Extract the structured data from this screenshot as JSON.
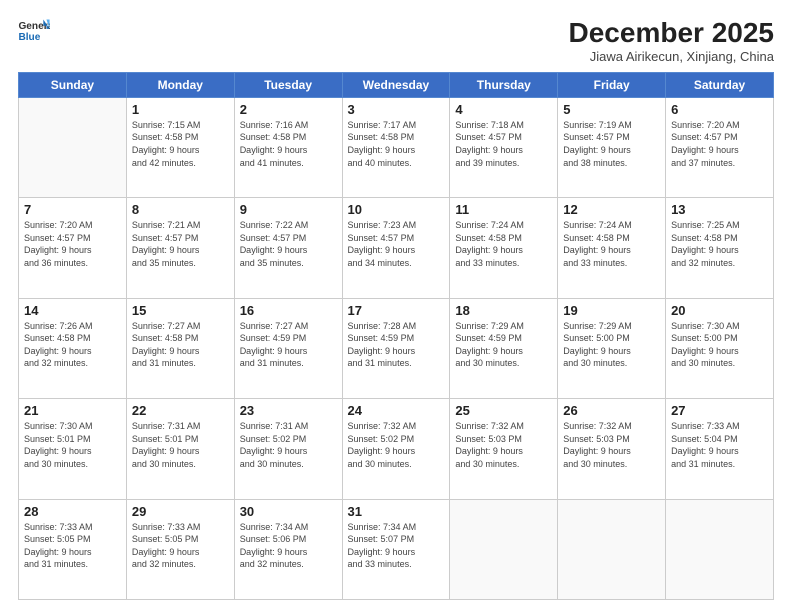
{
  "logo": {
    "line1": "General",
    "line2": "Blue"
  },
  "title": "December 2025",
  "subtitle": "Jiawa Airikecun, Xinjiang, China",
  "days_of_week": [
    "Sunday",
    "Monday",
    "Tuesday",
    "Wednesday",
    "Thursday",
    "Friday",
    "Saturday"
  ],
  "weeks": [
    [
      {
        "day": "",
        "info": ""
      },
      {
        "day": "1",
        "info": "Sunrise: 7:15 AM\nSunset: 4:58 PM\nDaylight: 9 hours\nand 42 minutes."
      },
      {
        "day": "2",
        "info": "Sunrise: 7:16 AM\nSunset: 4:58 PM\nDaylight: 9 hours\nand 41 minutes."
      },
      {
        "day": "3",
        "info": "Sunrise: 7:17 AM\nSunset: 4:58 PM\nDaylight: 9 hours\nand 40 minutes."
      },
      {
        "day": "4",
        "info": "Sunrise: 7:18 AM\nSunset: 4:57 PM\nDaylight: 9 hours\nand 39 minutes."
      },
      {
        "day": "5",
        "info": "Sunrise: 7:19 AM\nSunset: 4:57 PM\nDaylight: 9 hours\nand 38 minutes."
      },
      {
        "day": "6",
        "info": "Sunrise: 7:20 AM\nSunset: 4:57 PM\nDaylight: 9 hours\nand 37 minutes."
      }
    ],
    [
      {
        "day": "7",
        "info": "Sunrise: 7:20 AM\nSunset: 4:57 PM\nDaylight: 9 hours\nand 36 minutes."
      },
      {
        "day": "8",
        "info": "Sunrise: 7:21 AM\nSunset: 4:57 PM\nDaylight: 9 hours\nand 35 minutes."
      },
      {
        "day": "9",
        "info": "Sunrise: 7:22 AM\nSunset: 4:57 PM\nDaylight: 9 hours\nand 35 minutes."
      },
      {
        "day": "10",
        "info": "Sunrise: 7:23 AM\nSunset: 4:57 PM\nDaylight: 9 hours\nand 34 minutes."
      },
      {
        "day": "11",
        "info": "Sunrise: 7:24 AM\nSunset: 4:58 PM\nDaylight: 9 hours\nand 33 minutes."
      },
      {
        "day": "12",
        "info": "Sunrise: 7:24 AM\nSunset: 4:58 PM\nDaylight: 9 hours\nand 33 minutes."
      },
      {
        "day": "13",
        "info": "Sunrise: 7:25 AM\nSunset: 4:58 PM\nDaylight: 9 hours\nand 32 minutes."
      }
    ],
    [
      {
        "day": "14",
        "info": "Sunrise: 7:26 AM\nSunset: 4:58 PM\nDaylight: 9 hours\nand 32 minutes."
      },
      {
        "day": "15",
        "info": "Sunrise: 7:27 AM\nSunset: 4:58 PM\nDaylight: 9 hours\nand 31 minutes."
      },
      {
        "day": "16",
        "info": "Sunrise: 7:27 AM\nSunset: 4:59 PM\nDaylight: 9 hours\nand 31 minutes."
      },
      {
        "day": "17",
        "info": "Sunrise: 7:28 AM\nSunset: 4:59 PM\nDaylight: 9 hours\nand 31 minutes."
      },
      {
        "day": "18",
        "info": "Sunrise: 7:29 AM\nSunset: 4:59 PM\nDaylight: 9 hours\nand 30 minutes."
      },
      {
        "day": "19",
        "info": "Sunrise: 7:29 AM\nSunset: 5:00 PM\nDaylight: 9 hours\nand 30 minutes."
      },
      {
        "day": "20",
        "info": "Sunrise: 7:30 AM\nSunset: 5:00 PM\nDaylight: 9 hours\nand 30 minutes."
      }
    ],
    [
      {
        "day": "21",
        "info": "Sunrise: 7:30 AM\nSunset: 5:01 PM\nDaylight: 9 hours\nand 30 minutes."
      },
      {
        "day": "22",
        "info": "Sunrise: 7:31 AM\nSunset: 5:01 PM\nDaylight: 9 hours\nand 30 minutes."
      },
      {
        "day": "23",
        "info": "Sunrise: 7:31 AM\nSunset: 5:02 PM\nDaylight: 9 hours\nand 30 minutes."
      },
      {
        "day": "24",
        "info": "Sunrise: 7:32 AM\nSunset: 5:02 PM\nDaylight: 9 hours\nand 30 minutes."
      },
      {
        "day": "25",
        "info": "Sunrise: 7:32 AM\nSunset: 5:03 PM\nDaylight: 9 hours\nand 30 minutes."
      },
      {
        "day": "26",
        "info": "Sunrise: 7:32 AM\nSunset: 5:03 PM\nDaylight: 9 hours\nand 30 minutes."
      },
      {
        "day": "27",
        "info": "Sunrise: 7:33 AM\nSunset: 5:04 PM\nDaylight: 9 hours\nand 31 minutes."
      }
    ],
    [
      {
        "day": "28",
        "info": "Sunrise: 7:33 AM\nSunset: 5:05 PM\nDaylight: 9 hours\nand 31 minutes."
      },
      {
        "day": "29",
        "info": "Sunrise: 7:33 AM\nSunset: 5:05 PM\nDaylight: 9 hours\nand 32 minutes."
      },
      {
        "day": "30",
        "info": "Sunrise: 7:34 AM\nSunset: 5:06 PM\nDaylight: 9 hours\nand 32 minutes."
      },
      {
        "day": "31",
        "info": "Sunrise: 7:34 AM\nSunset: 5:07 PM\nDaylight: 9 hours\nand 33 minutes."
      },
      {
        "day": "",
        "info": ""
      },
      {
        "day": "",
        "info": ""
      },
      {
        "day": "",
        "info": ""
      }
    ]
  ]
}
